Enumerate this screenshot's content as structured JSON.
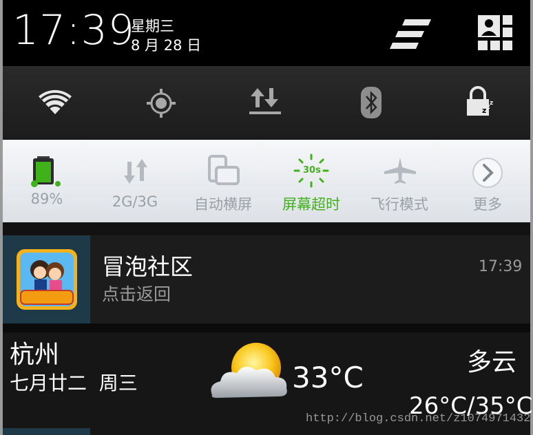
{
  "clock": {
    "time": "17:39",
    "weekday": "星期三",
    "date": "8 月 28 日"
  },
  "header_icons": [
    "list-icon",
    "user-grid-icon"
  ],
  "quick_toggles": [
    {
      "name": "wifi-icon"
    },
    {
      "name": "gps-icon"
    },
    {
      "name": "data-sync-icon"
    },
    {
      "name": "bluetooth-icon"
    },
    {
      "name": "screen-lock-sleep-icon"
    }
  ],
  "power_widget": {
    "battery": {
      "label": "89%",
      "level": 0.89
    },
    "network": {
      "label": "2G/3G"
    },
    "rotate": {
      "label": "自动横屏"
    },
    "timeout": {
      "label": "屏幕超时",
      "badge": "30s"
    },
    "airplane": {
      "label": "飞行模式"
    },
    "more": {
      "label": "更多"
    }
  },
  "notification": {
    "title": "冒泡社区",
    "subtitle": "点击返回",
    "time": "17:39"
  },
  "weather": {
    "city": "杭州",
    "lunar": "七月廿二  周三",
    "temp": "33°C",
    "condition": "多云",
    "range": "26°C/35°C"
  },
  "watermark": "http://blog.csdn.net/z1074971432",
  "colors": {
    "active_green": "#3fb21a",
    "header_bg": "#000000",
    "widget_bg": "#eef0f3"
  }
}
